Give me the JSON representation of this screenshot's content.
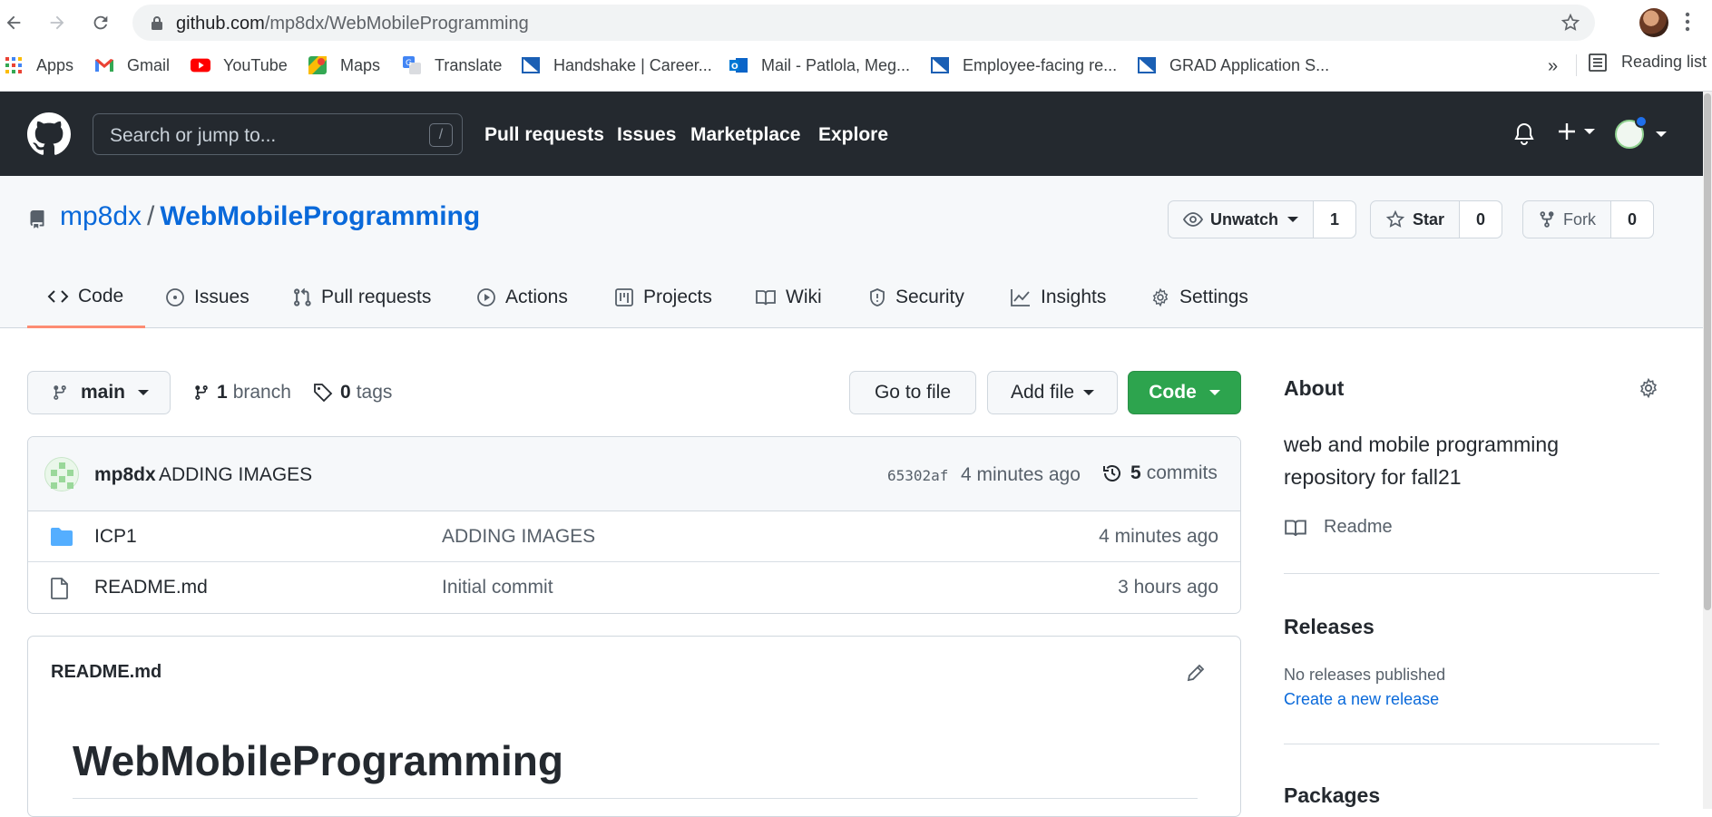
{
  "browser": {
    "url_host": "github.com",
    "url_path": "/mp8dx/WebMobileProgramming",
    "bookmarks": [
      {
        "label": "Apps",
        "icon": "apps-grid-icon"
      },
      {
        "label": "Gmail",
        "icon": "gmail-icon"
      },
      {
        "label": "YouTube",
        "icon": "youtube-icon"
      },
      {
        "label": "Maps",
        "icon": "maps-icon"
      },
      {
        "label": "Translate",
        "icon": "translate-icon"
      },
      {
        "label": "Handshake | Career...",
        "icon": "bookmark-flag-icon"
      },
      {
        "label": "Mail - Patlola, Meg...",
        "icon": "outlook-icon"
      },
      {
        "label": "Employee-facing re...",
        "icon": "bookmark-flag-icon"
      },
      {
        "label": "GRAD Application S...",
        "icon": "bookmark-flag-icon"
      }
    ],
    "more_bookmarks": "»",
    "reading_list": "Reading list"
  },
  "header": {
    "search_placeholder": "Search or jump to...",
    "search_shortcut": "/",
    "nav": [
      "Pull requests",
      "Issues",
      "Marketplace",
      "Explore"
    ]
  },
  "repo": {
    "owner": "mp8dx",
    "separator": "/",
    "name": "WebMobileProgramming",
    "watch_label": "Unwatch",
    "watch_count": "1",
    "star_label": "Star",
    "star_count": "0",
    "fork_label": "Fork",
    "fork_count": "0",
    "tabs": [
      "Code",
      "Issues",
      "Pull requests",
      "Actions",
      "Projects",
      "Wiki",
      "Security",
      "Insights",
      "Settings"
    ],
    "active_tab": "Code"
  },
  "main": {
    "branch": "main",
    "branch_count": "1",
    "branch_word": "branch",
    "tag_count": "0",
    "tag_word": "tags",
    "go_to_file": "Go to file",
    "add_file": "Add file",
    "code_button": "Code",
    "commit": {
      "author": "mp8dx",
      "message": "ADDING IMAGES",
      "sha": "65302af",
      "time": "4 minutes ago",
      "count": "5",
      "count_word": "commits"
    },
    "files": [
      {
        "name": "ICP1",
        "type": "folder",
        "message": "ADDING IMAGES",
        "time": "4 minutes ago"
      },
      {
        "name": "README.md",
        "type": "file",
        "message": "Initial commit",
        "time": "3 hours ago"
      }
    ],
    "readme": {
      "label": "README.md",
      "heading": "WebMobileProgramming"
    }
  },
  "sidebar": {
    "about_title": "About",
    "description": "web and mobile programming repository for fall21",
    "readme_link": "Readme",
    "releases_title": "Releases",
    "no_releases": "No releases published",
    "create_release": "Create a new release",
    "packages_title": "Packages"
  },
  "colors": {
    "header_bg": "#24292f",
    "link": "#0969da",
    "green_button": "#2da44e",
    "active_tab_underline": "#fd8c73",
    "folder": "#54aeff"
  }
}
